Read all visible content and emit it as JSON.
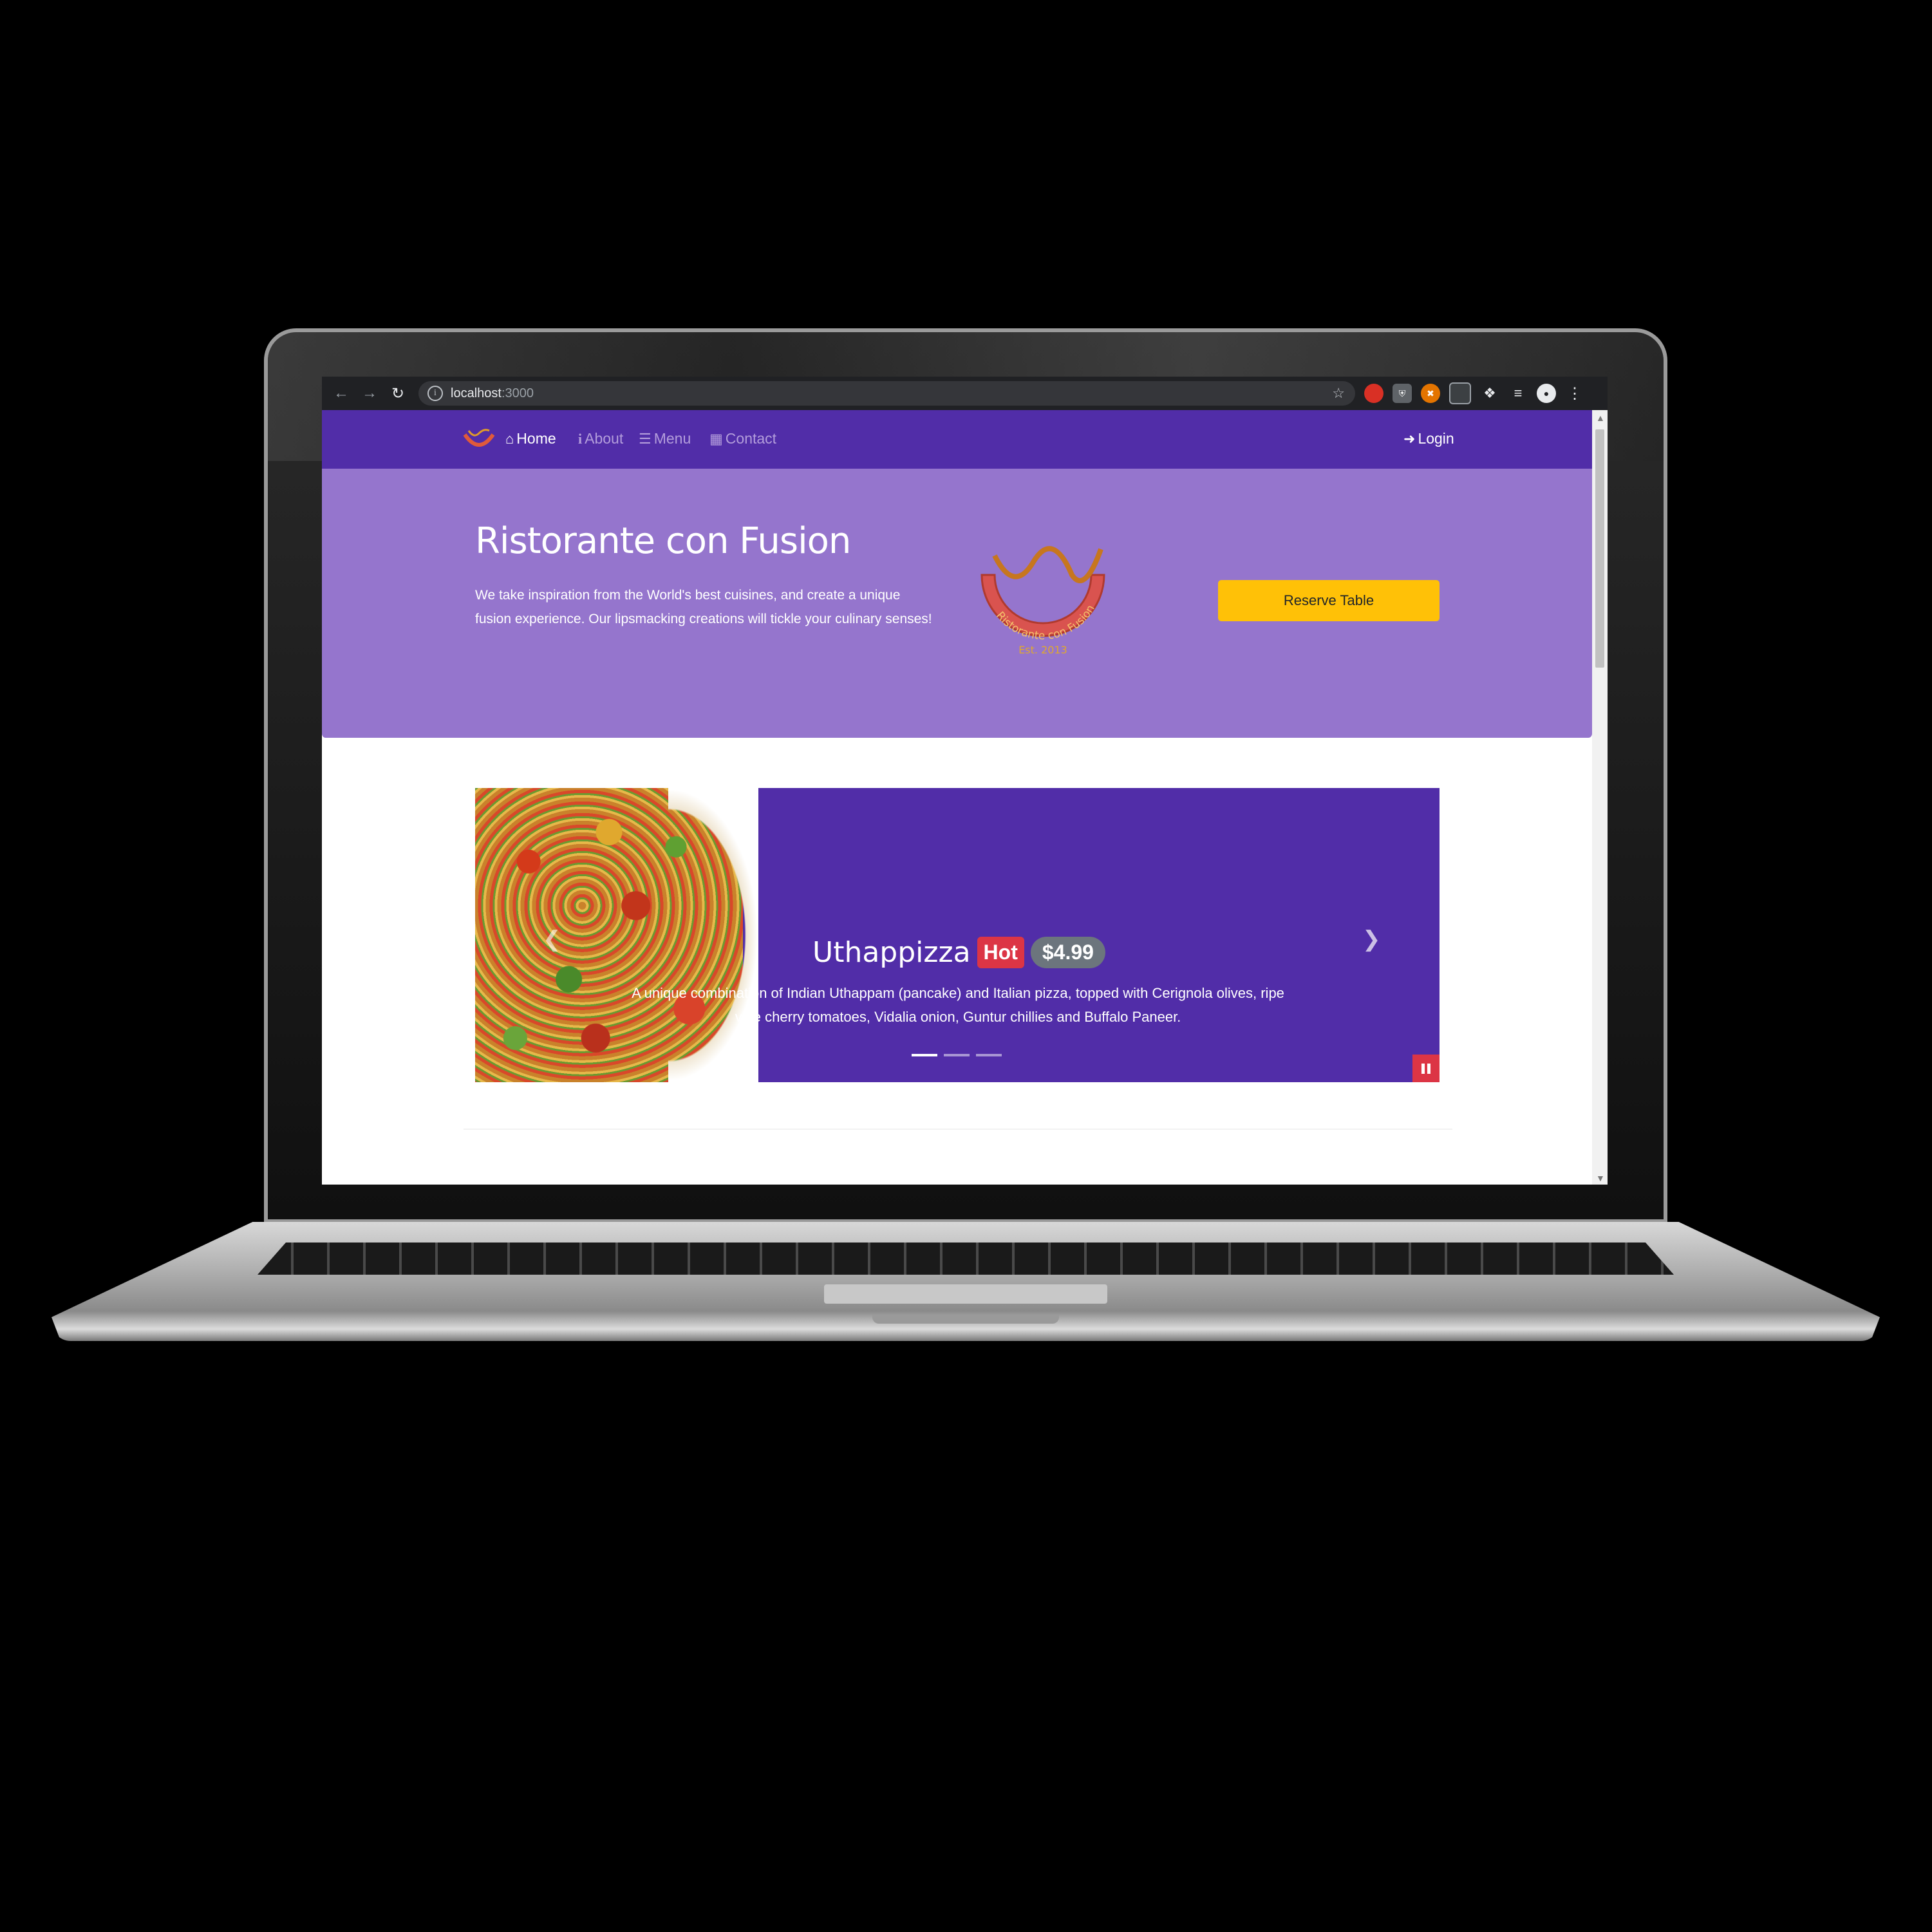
{
  "browser": {
    "url_host": "localhost",
    "url_port": ":3000",
    "back_icon": "arrow-left-icon",
    "forward_icon": "arrow-right-icon",
    "reload_icon": "reload-icon",
    "bookmark_icon": "star-icon"
  },
  "navbar": {
    "items": [
      {
        "label": "Home",
        "icon": "home-icon",
        "active": true
      },
      {
        "label": "About",
        "icon": "info-icon",
        "active": false
      },
      {
        "label": "Menu",
        "icon": "list-icon",
        "active": false
      },
      {
        "label": "Contact",
        "icon": "address-card-icon",
        "active": false
      }
    ],
    "login_label": "Login"
  },
  "jumbotron": {
    "title": "Ristorante con Fusion",
    "description": "We take inspiration from the World's best cuisines, and create a unique fusion experience. Our lipsmacking creations will tickle your culinary senses!",
    "logo_text": "Ristorante con Fusion",
    "logo_est": "Est. 2013",
    "reserve_label": "Reserve Table"
  },
  "carousel": {
    "dish_name": "Uthappizza",
    "label": "Hot",
    "price": "$4.99",
    "description": "A unique combination of Indian Uthappam (pancake) and Italian pizza, topped with Cerignola olives, ripe vine cherry tomatoes, Vidalia onion, Guntur chillies and Buffalo Paneer.",
    "active_slide": 1,
    "slide_count": 3
  },
  "colors": {
    "primary": "#512da8",
    "jumbotron": "#9575cd",
    "reserve": "#ffc107",
    "hot_badge": "#dc3545",
    "price_badge": "#6c757d"
  }
}
